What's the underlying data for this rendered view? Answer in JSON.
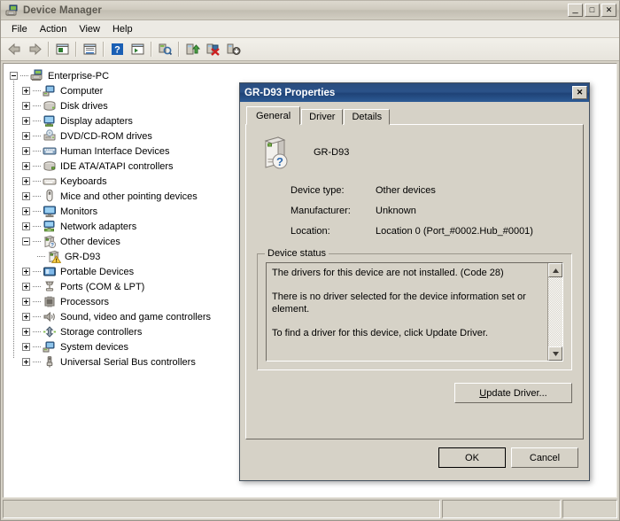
{
  "window": {
    "title": "Device Manager",
    "icon": "device-manager-icon",
    "caption_buttons": {
      "minimize": "_",
      "maximize": "□",
      "close": "✕"
    }
  },
  "menu": {
    "items": [
      {
        "label": "File"
      },
      {
        "label": "Action"
      },
      {
        "label": "View"
      },
      {
        "label": "Help"
      }
    ]
  },
  "toolbar": {
    "buttons": [
      {
        "name": "back-icon",
        "tooltip": "Back"
      },
      {
        "name": "forward-icon",
        "tooltip": "Forward"
      },
      {
        "name": "show-console-tree-icon",
        "tooltip": "Show/Hide Console Tree"
      },
      {
        "name": "properties-icon",
        "tooltip": "Properties"
      },
      {
        "name": "help-icon",
        "tooltip": "Help"
      },
      {
        "name": "show-hidden-devices-icon",
        "tooltip": "Show hidden devices"
      },
      {
        "name": "scan-for-hardware-changes-icon",
        "tooltip": "Scan for hardware changes"
      },
      {
        "name": "update-driver-software-icon",
        "tooltip": "Update Driver Software"
      },
      {
        "name": "disable-device-icon",
        "tooltip": "Disable"
      },
      {
        "name": "uninstall-device-icon",
        "tooltip": "Uninstall"
      }
    ]
  },
  "tree": {
    "root": {
      "label": "Enterprise-PC",
      "icon": "computer-root-icon",
      "expanded": true
    },
    "items": [
      {
        "label": "Computer",
        "icon": "computer-icon",
        "expanded": false
      },
      {
        "label": "Disk drives",
        "icon": "disk-drive-icon",
        "expanded": false
      },
      {
        "label": "Display adapters",
        "icon": "display-adapter-icon",
        "expanded": false
      },
      {
        "label": "DVD/CD-ROM drives",
        "icon": "dvd-drive-icon",
        "expanded": false
      },
      {
        "label": "Human Interface Devices",
        "icon": "hid-icon",
        "expanded": false
      },
      {
        "label": "IDE ATA/ATAPI controllers",
        "icon": "ide-controller-icon",
        "expanded": false
      },
      {
        "label": "Keyboards",
        "icon": "keyboard-icon",
        "expanded": false
      },
      {
        "label": "Mice and other pointing devices",
        "icon": "mouse-icon",
        "expanded": false
      },
      {
        "label": "Monitors",
        "icon": "monitor-icon",
        "expanded": false
      },
      {
        "label": "Network adapters",
        "icon": "network-adapter-icon",
        "expanded": false
      },
      {
        "label": "Other devices",
        "icon": "other-devices-icon",
        "expanded": true
      },
      {
        "label": "Portable Devices",
        "icon": "portable-device-icon",
        "expanded": false
      },
      {
        "label": "Ports (COM & LPT)",
        "icon": "ports-icon",
        "expanded": false
      },
      {
        "label": "Processors",
        "icon": "processor-icon",
        "expanded": false
      },
      {
        "label": "Sound, video and game controllers",
        "icon": "sound-controller-icon",
        "expanded": false
      },
      {
        "label": "Storage controllers",
        "icon": "storage-controller-icon",
        "expanded": false
      },
      {
        "label": "System devices",
        "icon": "system-device-icon",
        "expanded": false
      },
      {
        "label": "Universal Serial Bus controllers",
        "icon": "usb-controller-icon",
        "expanded": false
      }
    ],
    "child_device": {
      "label": "GR-D93",
      "icon": "unknown-device-warning-icon"
    }
  },
  "status_bar": {
    "main": "",
    "pane_a": "",
    "pane_b": ""
  },
  "dialog": {
    "title": "GR-D93 Properties",
    "close_label": "✕",
    "tabs": [
      {
        "label": "General",
        "active": true
      },
      {
        "label": "Driver",
        "active": false
      },
      {
        "label": "Details",
        "active": false
      }
    ],
    "device": {
      "name": "GR-D93",
      "icon": "unknown-device-icon"
    },
    "info": [
      {
        "label": "Device type:",
        "value": "Other devices"
      },
      {
        "label": "Manufacturer:",
        "value": "Unknown"
      },
      {
        "label": "Location:",
        "value": "Location 0 (Port_#0002.Hub_#0001)"
      }
    ],
    "device_status": {
      "group_title": "Device status",
      "lines": [
        "The drivers for this device are not installed. (Code 28)",
        "There is no driver selected for the device information set or element.",
        "To find a driver for this device, click Update Driver."
      ],
      "scroll_up": "▲",
      "scroll_down": "▼"
    },
    "buttons": {
      "update_driver": "Update Driver...",
      "update_driver_accel": "U",
      "ok": "OK",
      "cancel": "Cancel"
    }
  },
  "colors": {
    "dialog_titlebar_blue": "#2b5289",
    "window_face": "#d6d2c7",
    "warning_yellow": "#ffd24a",
    "help_blue": "#1a5fb4",
    "client_white": "#ffffff"
  }
}
